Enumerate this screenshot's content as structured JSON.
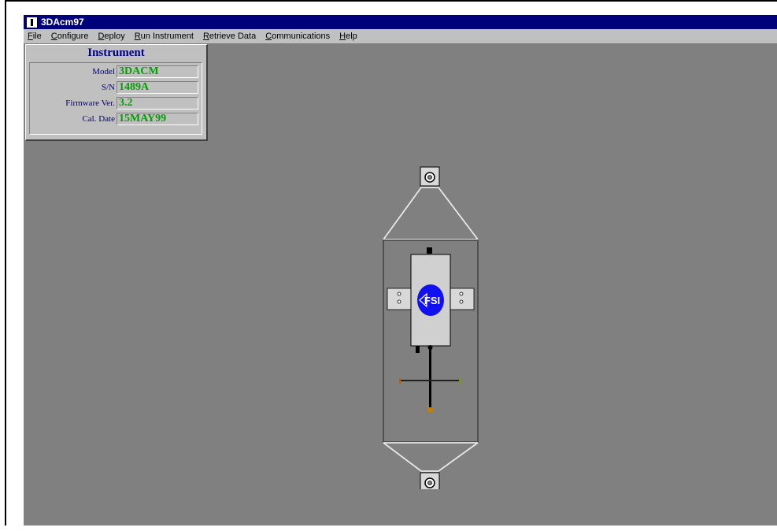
{
  "window": {
    "title": "3DAcm97"
  },
  "menu": {
    "items": [
      {
        "ul": "F",
        "rest": "ile"
      },
      {
        "ul": "C",
        "rest": "onfigure"
      },
      {
        "ul": "D",
        "rest": "eploy"
      },
      {
        "ul": "R",
        "rest": "un Instrument"
      },
      {
        "ul": "R",
        "rest": "etrieve Data"
      },
      {
        "ul": "C",
        "rest": "ommunications"
      },
      {
        "ul": "H",
        "rest": "elp"
      }
    ]
  },
  "instrument": {
    "title": "Instrument",
    "fields": [
      {
        "label": "Model",
        "value": "3DACM"
      },
      {
        "label": "S/N",
        "value": "1489A"
      },
      {
        "label": "Firmware Ver.",
        "value": "3.2"
      },
      {
        "label": "Cal. Date",
        "value": "15MAY99"
      }
    ]
  },
  "diagram": {
    "logo_text": "FSI",
    "logo_color": "#1010f0"
  },
  "colors": {
    "title_bar": "#00007b",
    "desktop": "#808080",
    "menu_bg": "#c0c0c0",
    "value_text": "#00a000",
    "label_text": "#000080"
  }
}
